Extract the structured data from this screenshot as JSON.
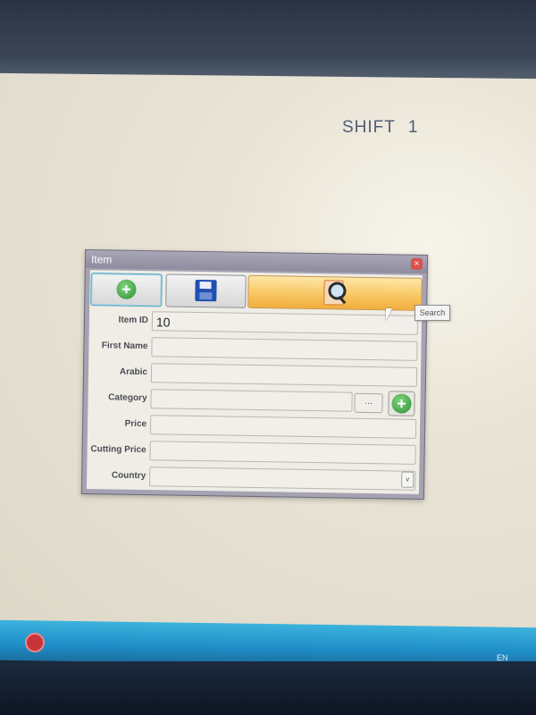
{
  "desktop": {
    "shift_label": "SHIFT",
    "shift_number": "1"
  },
  "window": {
    "title": "Item",
    "close_glyph": "×",
    "toolbar": {
      "add_icon": "add-circle-icon",
      "save_icon": "floppy-disk-icon",
      "search_icon": "search-document-icon",
      "search_tooltip": "Search"
    },
    "fields": {
      "item_id": {
        "label": "Item ID",
        "value": "10"
      },
      "first_name": {
        "label": "First Name",
        "value": ""
      },
      "arabic": {
        "label": "Arabic",
        "value": ""
      },
      "category": {
        "label": "Category",
        "value": "",
        "browse_label": "..."
      },
      "price": {
        "label": "Price",
        "value": ""
      },
      "cutting_price": {
        "label": "Cutting Price",
        "value": ""
      },
      "country": {
        "label": "Country",
        "value": "",
        "dropdown_glyph": "v"
      }
    }
  },
  "taskbar": {
    "tray_language": "EN"
  },
  "colors": {
    "search_button": "#f8c763",
    "add_green": "#2f8f35",
    "save_blue": "#1f4fb0",
    "taskbar": "#1f8ec8"
  }
}
